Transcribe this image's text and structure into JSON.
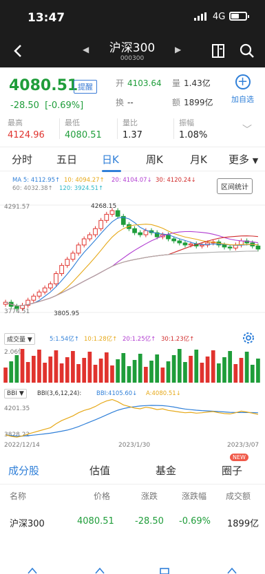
{
  "status_bar": {
    "time": "13:47",
    "network": "4G"
  },
  "nav": {
    "title": "沪深300",
    "code": "000300"
  },
  "quote": {
    "price": "4080.51",
    "remind_label": "提醒",
    "change": "-28.50",
    "change_pct": "[-0.69%]",
    "open_label": "开",
    "open_value": "4103.64",
    "volume_label": "量",
    "volume_value": "1.43亿",
    "turnover_label": "换",
    "turnover_value": "--",
    "amount_label": "额",
    "amount_value": "1899亿",
    "add_label": "加自选",
    "high_label": "最高",
    "high_value": "4124.96",
    "low_label": "最低",
    "low_value": "4080.51",
    "volratio_label": "量比",
    "volratio_value": "1.37",
    "amplitude_label": "振幅",
    "amplitude_value": "1.08%"
  },
  "period_tabs": [
    "分时",
    "五日",
    "日K",
    "周K",
    "月K",
    "更多"
  ],
  "active_period": "日K",
  "ma_legend": {
    "ma5": "MA 5: 4112.95↑",
    "ma10": "10: 4094.27↑",
    "ma20": "20: 4104.07↓",
    "ma30": "30: 4120.24↓",
    "ma60": "60: 4032.38↑",
    "ma120": "120: 3924.51↑",
    "stat_button": "区间统计"
  },
  "kline_labels": {
    "top_left": "4291.57",
    "peak": "4268.15",
    "low_left": "3774.51",
    "low_mark": "3805.95"
  },
  "volume_panel": {
    "selector": "成交量 ▼",
    "v5": "5:1.54亿↑",
    "v10": "10:1.28亿↑",
    "v20": "20:1.25亿↑",
    "v30": "30:1.23亿↑",
    "max_label": "2.06亿"
  },
  "bbi_panel": {
    "selector": "BBI ▼",
    "params": "BBI(3,6,12,24):",
    "bbi_value": "BBI:4105.60↓",
    "a_value": "A:4080.51↓",
    "high_label": "4201.35",
    "low_label": "3828.22"
  },
  "dates": [
    "2022/12/14",
    "2023/1/30",
    "2023/3/07"
  ],
  "sub_tabs": [
    "成分股",
    "估值",
    "基金",
    "圈子"
  ],
  "new_badge": "NEW",
  "table": {
    "headers": [
      "名称",
      "价格",
      "涨跌",
      "涨跌幅",
      "成交额"
    ],
    "rows": [
      [
        "沪深300",
        "4080.51",
        "-28.50",
        "-0.69%",
        "1899亿"
      ]
    ]
  },
  "colors": {
    "up": "#e0332e",
    "down": "#1f9d3a",
    "accent": "#2f7fd8"
  },
  "chart_data": {
    "type": "candlestick",
    "close_series": [
      3820,
      3800,
      3790,
      3805,
      3830,
      3850,
      3870,
      3890,
      3910,
      3960,
      4000,
      4030,
      4060,
      4100,
      4130,
      4150,
      4180,
      4220,
      4250,
      4268,
      4240,
      4200,
      4180,
      4160,
      4150,
      4170,
      4160,
      4140,
      4150,
      4130,
      4120,
      4110,
      4100,
      4105,
      4095,
      4100,
      4110,
      4115,
      4100,
      4090,
      4085,
      4100,
      4120,
      4110,
      4095,
      4080
    ]
  }
}
